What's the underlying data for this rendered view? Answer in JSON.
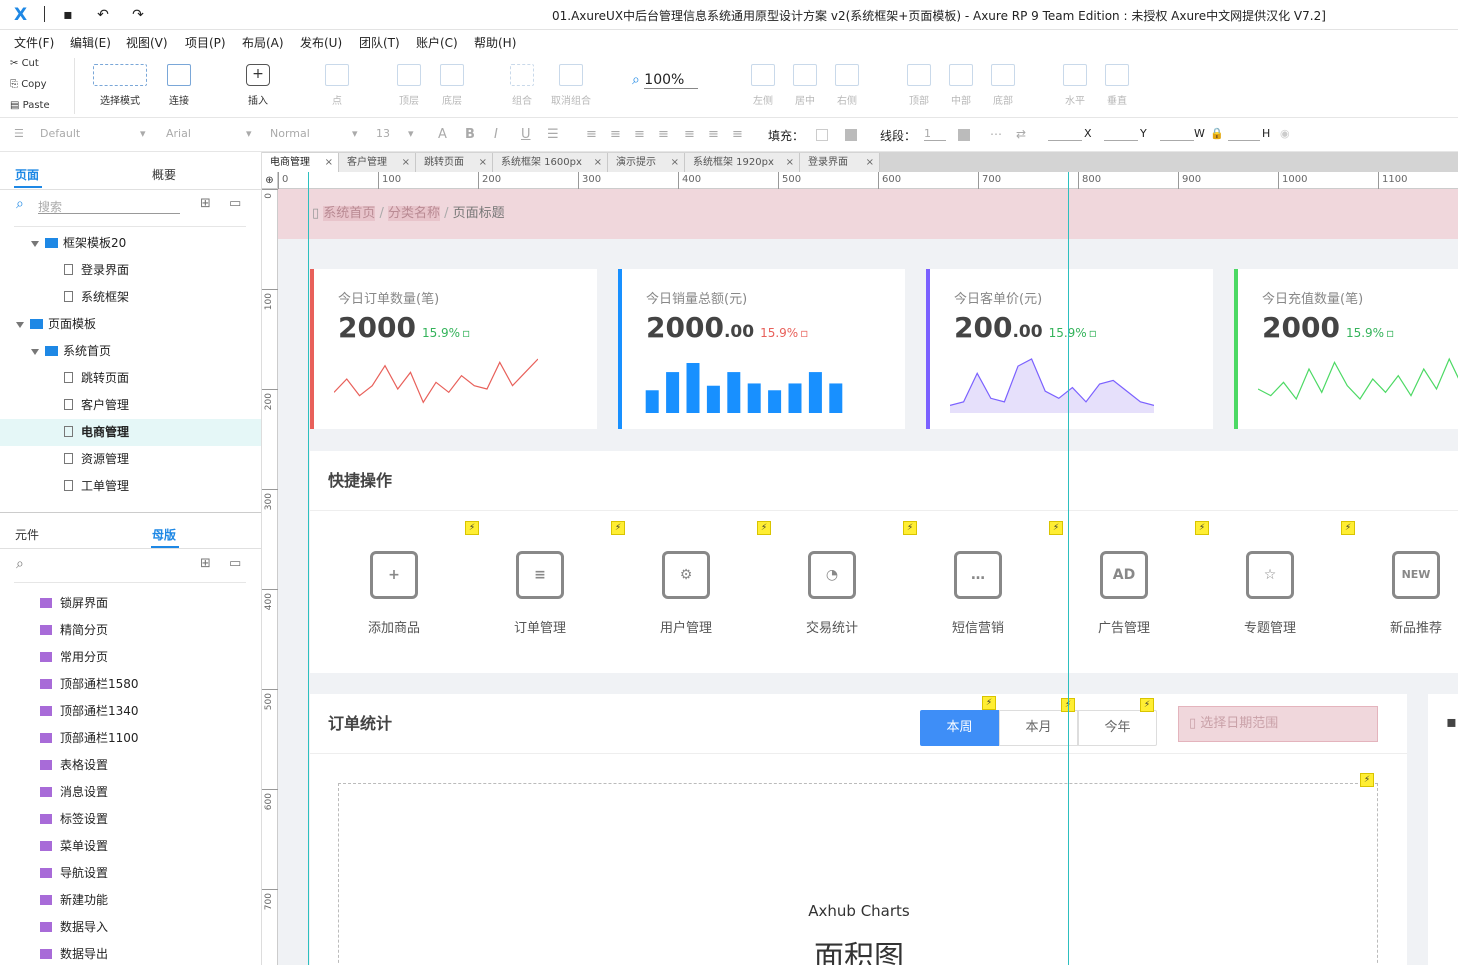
{
  "titlebar": {
    "title": "01.AxureUX中后台管理信息系统通用原型设计方案 v2(系统框架+页面模板) - Axure RP 9 Team Edition : 未授权    Axure中文网提供汉化 V7.2]"
  },
  "menu": [
    "文件(F)",
    "编辑(E)",
    "视图(V)",
    "项目(P)",
    "布局(A)",
    "发布(U)",
    "团队(T)",
    "账户(C)",
    "帮助(H)"
  ],
  "clipboard": [
    "Cut",
    "Copy",
    "Paste"
  ],
  "tools": [
    "选择模式",
    "连接",
    "插入",
    "点",
    "顶层",
    "底层",
    "组合",
    "取消组合",
    "左侧",
    "居中",
    "右侧",
    "顶部",
    "中部",
    "底部",
    "水平",
    "垂直"
  ],
  "zoom": "100%",
  "format": {
    "style": "Default",
    "font": "Arial",
    "weight": "Normal",
    "size": "13",
    "fill": "填充：",
    "stroke": "线段：",
    "stroke_val": "1",
    "x": "X",
    "y": "Y",
    "w": "W",
    "h": "H"
  },
  "panel_tabs": {
    "pages": "页面",
    "outline": "概要",
    "widgets": "元件",
    "masters": "母版"
  },
  "search": {
    "placeholder": "搜索"
  },
  "tree": [
    {
      "label": "框架模板20",
      "type": "folder",
      "level": 1,
      "open": true
    },
    {
      "label": "登录界面",
      "type": "page",
      "level": 2
    },
    {
      "label": "系统框架",
      "type": "page",
      "level": 2
    },
    {
      "label": "页面模板",
      "type": "folder",
      "level": 0,
      "open": true
    },
    {
      "label": "系统首页",
      "type": "folder",
      "level": 1,
      "open": true
    },
    {
      "label": "跳转页面",
      "type": "page",
      "level": 2
    },
    {
      "label": "客户管理",
      "type": "page",
      "level": 2
    },
    {
      "label": "电商管理",
      "type": "page",
      "level": 2,
      "selected": true
    },
    {
      "label": "资源管理",
      "type": "page",
      "level": 2
    },
    {
      "label": "工单管理",
      "type": "page",
      "level": 2
    }
  ],
  "masters": [
    "锁屏界面",
    "精简分页",
    "常用分页",
    "顶部通栏1580",
    "顶部通栏1340",
    "顶部通栏1100",
    "表格设置",
    "消息设置",
    "标签设置",
    "菜单设置",
    "导航设置",
    "新建功能",
    "数据导入",
    "数据导出"
  ],
  "doc_tabs": [
    "电商管理",
    "客户管理",
    "跳转页面",
    "系统框架 1600px",
    "演示提示",
    "系统框架 1920px",
    "登录界面"
  ],
  "ruler_h": [
    "0",
    "100",
    "200",
    "300",
    "400",
    "500",
    "600",
    "700",
    "800",
    "900",
    "1000",
    "1100"
  ],
  "ruler_v": [
    "0",
    "100",
    "200",
    "300",
    "400",
    "500",
    "600",
    "700"
  ],
  "breadcrumb": [
    "系统首页",
    "分类名称",
    "页面标题"
  ],
  "cards": [
    {
      "title": "今日订单数量(笔)",
      "value": "2000",
      "decimal": "",
      "pct": "15.9%",
      "color": "#e8605a",
      "pct_color": "#34b35a",
      "chart": "line"
    },
    {
      "title": "今日销量总额(元)",
      "value": "2000",
      "decimal": ".00",
      "pct": "15.9%",
      "color": "#1890ff",
      "pct_color": "#e8605a",
      "chart": "bar"
    },
    {
      "title": "今日客单价(元)",
      "value": "200",
      "decimal": ".00",
      "pct": "15.9%",
      "color": "#7b61ff",
      "pct_color": "#34b35a",
      "chart": "area"
    },
    {
      "title": "今日充值数量(笔)",
      "value": "2000",
      "decimal": "",
      "pct": "15.9%",
      "color": "#4cd964",
      "pct_color": "#34b35a",
      "chart": "line2"
    }
  ],
  "quick": {
    "title": "快捷操作",
    "items": [
      {
        "label": "添加商品",
        "icon": "add-product-icon",
        "glyph": "+"
      },
      {
        "label": "订单管理",
        "icon": "order-icon",
        "glyph": "≡"
      },
      {
        "label": "用户管理",
        "icon": "user-gear-icon",
        "glyph": "⚙"
      },
      {
        "label": "交易统计",
        "icon": "pie-chart-icon",
        "glyph": "◔"
      },
      {
        "label": "短信营销",
        "icon": "sms-icon",
        "glyph": "…"
      },
      {
        "label": "广告管理",
        "icon": "ad-icon",
        "glyph": "AD"
      },
      {
        "label": "专题管理",
        "icon": "star-icon",
        "glyph": "☆"
      },
      {
        "label": "新品推荐",
        "icon": "new-icon",
        "glyph": "NEW"
      }
    ]
  },
  "orders": {
    "title": "订单统计",
    "segments": [
      "本周",
      "本月",
      "今年"
    ],
    "date_placeholder": "选择日期范围",
    "chart_caption": "Axhub Charts",
    "chart_title": "面积图"
  },
  "chart_data": [
    {
      "type": "line",
      "color": "#e8605a",
      "values": [
        10,
        18,
        8,
        14,
        26,
        12,
        22,
        4,
        16,
        10,
        20,
        14,
        12,
        28,
        14,
        22,
        30
      ]
    },
    {
      "type": "bar",
      "color": "#1890ff",
      "values": [
        20,
        36,
        44,
        24,
        36,
        26,
        20,
        26,
        36,
        26
      ]
    },
    {
      "type": "area",
      "color": "#7b61ff",
      "values": [
        2,
        4,
        20,
        6,
        4,
        24,
        28,
        10,
        6,
        12,
        4,
        14,
        16,
        10,
        4,
        2
      ]
    },
    {
      "type": "line",
      "color": "#4cd964",
      "values": [
        12,
        8,
        16,
        6,
        24,
        10,
        28,
        14,
        6,
        18,
        10,
        20,
        8,
        24,
        12,
        30,
        14
      ]
    }
  ]
}
